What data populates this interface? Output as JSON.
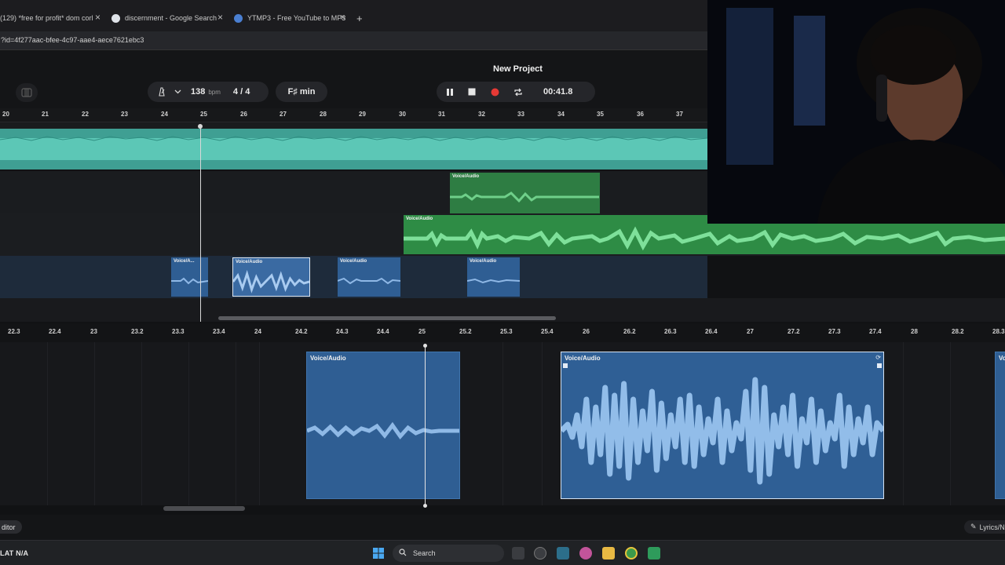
{
  "browser": {
    "tabs": [
      {
        "title": "(129) *free for profit* dom corl"
      },
      {
        "title": "discernment - Google Search"
      },
      {
        "title": "YTMP3 - Free YouTube to MP3"
      }
    ],
    "new_tab_symbol": "+",
    "close_symbol": "×",
    "address": "?id=4f277aac-bfee-4c97-aae4-aece7621ebc3"
  },
  "project": {
    "title": "New Project"
  },
  "toolbar": {
    "bpm_value": "138",
    "bpm_unit": "bpm",
    "time_sig": "4 / 4",
    "key": "F♯ min",
    "time_display": "00:41.8"
  },
  "timeline": {
    "bar_numbers": [
      "20",
      "21",
      "22",
      "23",
      "24",
      "25",
      "26",
      "27",
      "28",
      "29",
      "30",
      "31",
      "32",
      "33",
      "34",
      "35",
      "36",
      "37"
    ],
    "clip_label": "Voice/Audio",
    "short_clip_label": "Voice/A..."
  },
  "editor": {
    "ticks": [
      "22.3",
      "22.4",
      "23",
      "23.2",
      "23.3",
      "23.4",
      "24",
      "24.2",
      "24.3",
      "24.4",
      "25",
      "25.2",
      "25.3",
      "25.4",
      "26",
      "26.2",
      "26.3",
      "26.4",
      "27",
      "27.2",
      "27.3",
      "27.4",
      "28",
      "28.2",
      "28.3"
    ],
    "clip_label": "Voice/Audio",
    "tab_label": "ditor",
    "lyrics_label": "Lyrics/N"
  },
  "taskbar": {
    "weather_text": "LAT  N/A",
    "search_placeholder": "Search"
  },
  "colors": {
    "teal": "#4fb8a8",
    "green": "#3f9a55",
    "blue_clip": "#2f5e93",
    "record": "#e53935"
  }
}
